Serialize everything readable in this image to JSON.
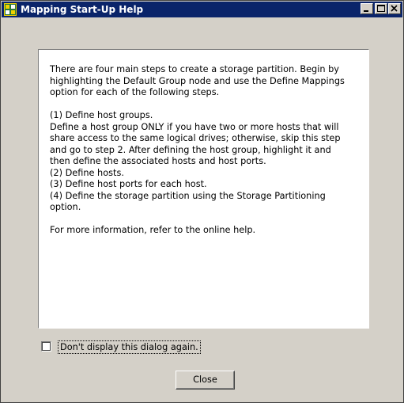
{
  "window": {
    "title": "Mapping Start-Up Help",
    "app_icon": "mapping-icon",
    "caption_buttons": [
      "minimize-icon",
      "maximize-icon",
      "close-icon"
    ],
    "titlebar_color": "#0a246a",
    "face_color": "#d4d0c8"
  },
  "help": {
    "intro_1": "There are four main steps to create a storage partition. Begin by",
    "intro_2": "highlighting the Default Group node and use the Define Mappings",
    "intro_3": "option for each of the following steps.",
    "step1_title": "(1) Define host groups.",
    "step1_desc_1": "Define a host group ONLY if you have two or more hosts that will",
    "step1_desc_2": "share access to the same logical drives; otherwise, skip this step",
    "step1_desc_3": "and go to step 2. After defining the host group, highlight it and",
    "step1_desc_4": "then define the associated hosts and host ports.",
    "step2": "(2) Define hosts.",
    "step3": "(3) Define host ports for each host.",
    "step4_1": "(4) Define the storage partition using the Storage Partitioning",
    "step4_2": "option.",
    "more_info": "For more information, refer to the online help."
  },
  "options": {
    "dont_display_label": "Don't display this dialog again.",
    "dont_display_checked": false
  },
  "buttons": {
    "close_label": "Close"
  }
}
